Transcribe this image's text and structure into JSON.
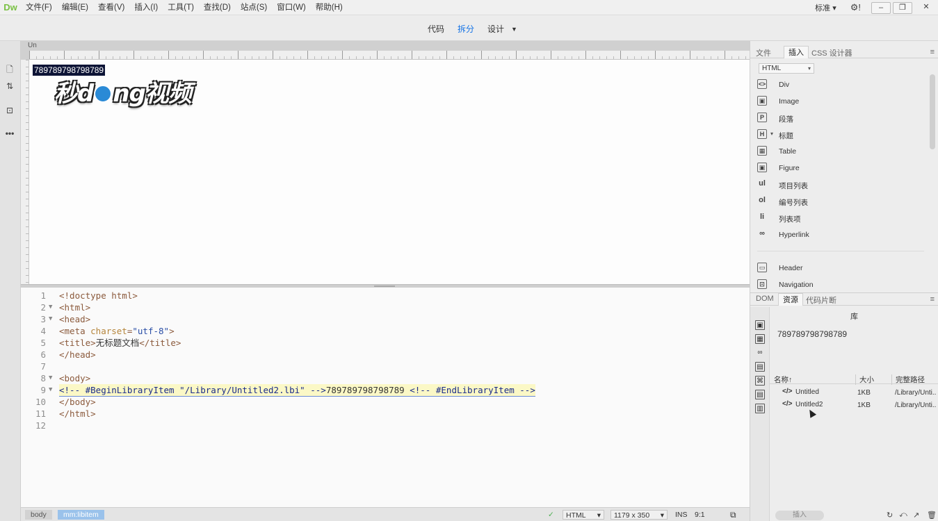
{
  "app": {
    "logo": "Dw"
  },
  "menu": [
    "文件(F)",
    "编辑(E)",
    "查看(V)",
    "插入(I)",
    "工具(T)",
    "查找(D)",
    "站点(S)",
    "窗口(W)",
    "帮助(H)"
  ],
  "menubar_right": {
    "workspace": "标准",
    "workspace_caret": "▾",
    "gear": "⚙!",
    "minimize": "–",
    "restore": "❐",
    "close": "✕"
  },
  "viewbar": {
    "code": "代码",
    "split": "拆分",
    "design": "设计",
    "caret": "▼"
  },
  "watermark": {
    "part1": "秒d",
    "part2": "ng视频"
  },
  "document": {
    "tab": "Un",
    "selected_text": "789789798798789"
  },
  "code_lines": [
    {
      "n": "1",
      "fold": ""
    },
    {
      "n": "2",
      "fold": "▼"
    },
    {
      "n": "3",
      "fold": "▼"
    },
    {
      "n": "4",
      "fold": ""
    },
    {
      "n": "5",
      "fold": ""
    },
    {
      "n": "6",
      "fold": ""
    },
    {
      "n": "7",
      "fold": ""
    },
    {
      "n": "8",
      "fold": "▼"
    },
    {
      "n": "9",
      "fold": "▼"
    },
    {
      "n": "10",
      "fold": ""
    },
    {
      "n": "11",
      "fold": ""
    },
    {
      "n": "12",
      "fold": ""
    }
  ],
  "code": {
    "l1": "<!doctype html>",
    "l2": "<html>",
    "l3": "<head>",
    "l4_open": "<meta ",
    "l4_attr": "charset",
    "l4_eq": "=",
    "l4_val": "\"utf-8\"",
    "l4_close": ">",
    "l5_open": "<title>",
    "l5_text": "无标题文档",
    "l5_close": "</title>",
    "l6": "</head>",
    "l8": "<body>",
    "l9_c1": "<!-- #BeginLibraryItem \"/Library/Untitled2.lbi\" -->",
    "l9_text": "789789798798789 ",
    "l9_c2": "<!-- #EndLibraryItem -->",
    "l10": "</body>",
    "l11": "</html>"
  },
  "statusbar": {
    "crumb1": "body",
    "crumb2": "mm:libitem",
    "valid_icon": "✓",
    "lang": "HTML",
    "lang_caret": "▾",
    "size": "1179 x 350",
    "size_caret": "▾",
    "ins": "INS",
    "pos": "9:1",
    "preview_icon": "⧉"
  },
  "insert_panel": {
    "tabs": [
      "文件",
      "插入",
      "CSS 设计器"
    ],
    "menu_icon": "≡",
    "select": "HTML",
    "select_caret": "▾",
    "items": [
      {
        "icon": "<>",
        "label": "Div"
      },
      {
        "icon": "▣",
        "label": "Image"
      },
      {
        "icon": "P",
        "label": "段落"
      },
      {
        "icon": "H",
        "label": "标题",
        "prefix": "▾"
      },
      {
        "icon": "▦",
        "label": "Table"
      },
      {
        "icon": "▣",
        "label": "Figure"
      },
      {
        "icon": "ul",
        "label": "项目列表"
      },
      {
        "icon": "ol",
        "label": "编号列表"
      },
      {
        "icon": "li",
        "label": "列表项"
      },
      {
        "icon": "∞",
        "label": "Hyperlink"
      },
      {
        "icon": "▭",
        "label": "Header"
      },
      {
        "icon": "⊡",
        "label": "Navigation"
      }
    ]
  },
  "assets_panel": {
    "tabs": [
      "DOM",
      "资源",
      "代码片断"
    ],
    "menu_icon": "≡",
    "library_title": "库",
    "preview": "789789798798789",
    "columns": {
      "name": "名称",
      "sort": "↑",
      "size": "大小",
      "path": "完整路径"
    },
    "rows": [
      {
        "name": "Untitled",
        "size": "1KB",
        "path": "/Library/Unti..."
      },
      {
        "name": "Untitled2",
        "size": "1KB",
        "path": "/Library/Unti..."
      }
    ],
    "insert_button": "插入",
    "side_icons": [
      "▣",
      "▦",
      "∞",
      "▤",
      "⌘",
      "▤",
      "▥"
    ],
    "bottom_icons": [
      "↻",
      "⤺",
      "↗",
      "🗑"
    ]
  }
}
